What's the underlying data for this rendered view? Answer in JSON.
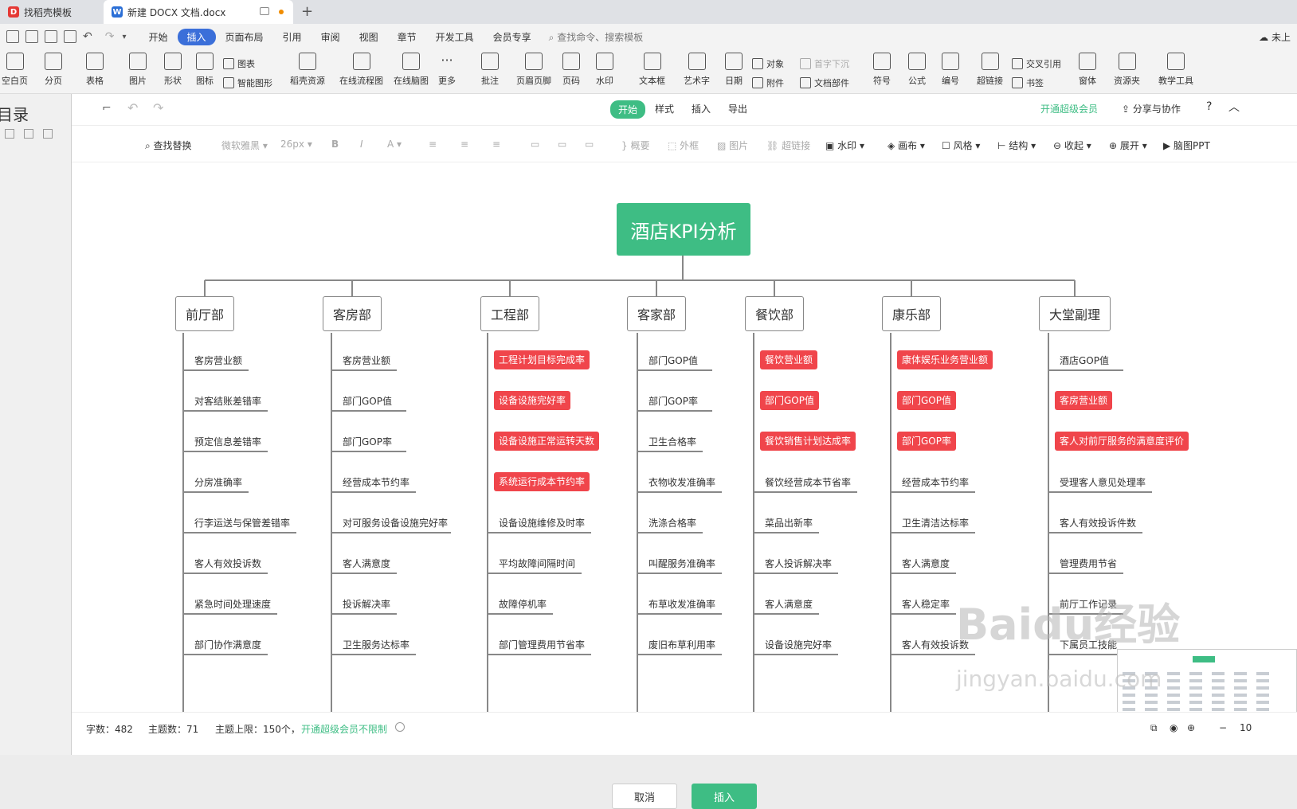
{
  "tabs": [
    {
      "label": "找稻壳模板"
    },
    {
      "label": "新建 DOCX 文档.docx"
    }
  ],
  "menus": [
    "开始",
    "插入",
    "页面布局",
    "引用",
    "审阅",
    "视图",
    "章节",
    "开发工具",
    "会员专享"
  ],
  "search_placeholder": "查找命令、搜索模板",
  "user_label": "未上",
  "ribbon": {
    "big": [
      "空白页",
      "分页",
      "表格",
      "图片",
      "形状",
      "稻壳资源",
      "在线流程图",
      "在线脑图",
      "更多",
      "批注",
      "页眉页脚",
      "页码",
      "水印",
      "文本框",
      "艺术字",
      "日期",
      "符号",
      "公式",
      "编号",
      "超链接",
      "窗体",
      "资源夹",
      "教学工具"
    ],
    "small": [
      "图表",
      "图标",
      "智能图形",
      "对象",
      "附件",
      "首字下沉",
      "文档部件",
      "交叉引用",
      "书签"
    ]
  },
  "sidebar_title": "目录",
  "dialog": {
    "tabs": [
      "开始",
      "样式",
      "插入",
      "导出"
    ],
    "vip": "开通超级会员",
    "share": "分享与协作",
    "help": "?"
  },
  "format": {
    "find": "查找替换",
    "font": "微软雅黑",
    "size": "26px",
    "bold": "B",
    "italic": "I",
    "color": "A",
    "summary": "概要",
    "outer": "外框",
    "image": "图片",
    "link": "超链接",
    "watermark": "水印",
    "canvas": "画布",
    "style": "风格",
    "structure": "结构",
    "collapse": "收起",
    "expand": "展开",
    "ppt": "脑图PPT"
  },
  "mindmap": {
    "root": "酒店KPI分析",
    "depts": [
      {
        "name": "前厅部",
        "items": [
          {
            "t": "客房营业额"
          },
          {
            "t": "对客结账差错率"
          },
          {
            "t": "预定信息差错率"
          },
          {
            "t": "分房准确率"
          },
          {
            "t": "行李运送与保管差错率"
          },
          {
            "t": "客人有效投诉数"
          },
          {
            "t": "紧急时间处理速度"
          },
          {
            "t": "部门协作满意度"
          }
        ]
      },
      {
        "name": "客房部",
        "items": [
          {
            "t": "客房营业额"
          },
          {
            "t": "部门GOP值"
          },
          {
            "t": "部门GOP率"
          },
          {
            "t": "经营成本节约率"
          },
          {
            "t": "对可服务设备设施完好率"
          },
          {
            "t": "客人满意度"
          },
          {
            "t": "投诉解决率"
          },
          {
            "t": "卫生服务达标率"
          }
        ]
      },
      {
        "name": "工程部",
        "items": [
          {
            "t": "工程计划目标完成率",
            "h": true
          },
          {
            "t": "设备设施完好率",
            "h": true
          },
          {
            "t": "设备设施正常运转天数",
            "h": true
          },
          {
            "t": "系统运行成本节约率",
            "h": true
          },
          {
            "t": "设备设施维修及时率"
          },
          {
            "t": "平均故障间隔时间"
          },
          {
            "t": "故障停机率"
          },
          {
            "t": "部门管理费用节省率"
          }
        ]
      },
      {
        "name": "客家部",
        "items": [
          {
            "t": "部门GOP值"
          },
          {
            "t": "部门GOP率"
          },
          {
            "t": "卫生合格率"
          },
          {
            "t": "衣物收发准确率"
          },
          {
            "t": "洗涤合格率"
          },
          {
            "t": "叫醒服务准确率"
          },
          {
            "t": "布草收发准确率"
          },
          {
            "t": "废旧布草利用率"
          }
        ]
      },
      {
        "name": "餐饮部",
        "items": [
          {
            "t": "餐饮营业额",
            "h": true
          },
          {
            "t": "部门GOP值",
            "h": true
          },
          {
            "t": "餐饮销售计划达成率",
            "h": true
          },
          {
            "t": "餐饮经营成本节省率"
          },
          {
            "t": "菜品出新率"
          },
          {
            "t": "客人投诉解决率"
          },
          {
            "t": "客人满意度"
          },
          {
            "t": "设备设施完好率"
          }
        ]
      },
      {
        "name": "康乐部",
        "items": [
          {
            "t": "康体娱乐业务营业额",
            "h": true
          },
          {
            "t": "部门GOP值",
            "h": true
          },
          {
            "t": "部门GOP率",
            "h": true
          },
          {
            "t": "经营成本节约率"
          },
          {
            "t": "卫生清洁达标率"
          },
          {
            "t": "客人满意度"
          },
          {
            "t": "客人稳定率"
          },
          {
            "t": "客人有效投诉数"
          }
        ]
      },
      {
        "name": "大堂副理",
        "items": [
          {
            "t": "酒店GOP值"
          },
          {
            "t": "客房营业额",
            "h": true
          },
          {
            "t": "客人对前厅服务的满意度评价",
            "h": true
          },
          {
            "t": "受理客人意见处理率"
          },
          {
            "t": "客人有效投诉件数"
          },
          {
            "t": "管理费用节省"
          },
          {
            "t": "前厅工作记录"
          },
          {
            "t": "下属员工技能"
          }
        ]
      }
    ]
  },
  "status": {
    "words": "字数：482",
    "topics": "主题数：71",
    "limit": "主题上限：150个，",
    "vip_link": "开通超级会员不限制",
    "zoom": "10"
  },
  "buttons": {
    "cancel": "取消",
    "insert": "插入"
  },
  "watermark": {
    "text": "Baidu经验",
    "url": "jingyan.baidu.com"
  },
  "colors": {
    "green": "#3ebd84",
    "red": "#f0454b",
    "blue": "#3b6fd9"
  }
}
